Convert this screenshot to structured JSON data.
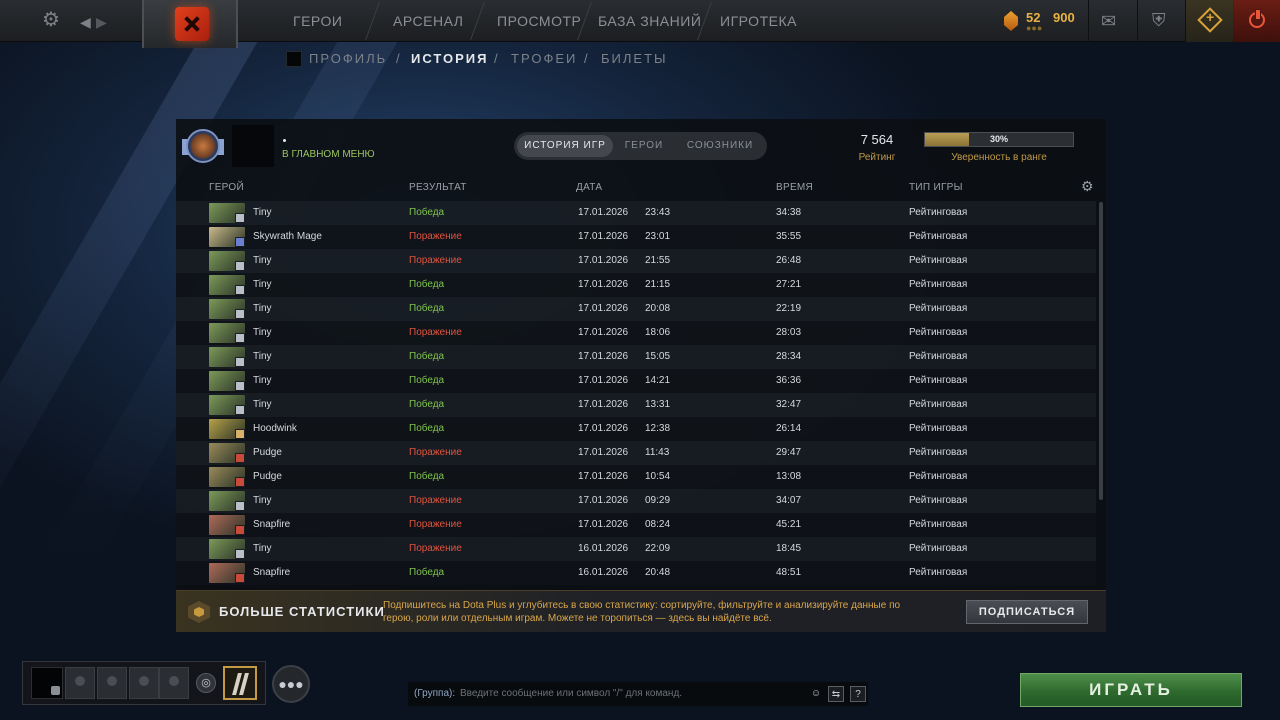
{
  "topbar": {
    "nav": [
      "ГЕРОИ",
      "АРСЕНАЛ",
      "ПРОСМОТР",
      "БАЗА ЗНАНИЙ",
      "ИГРОТЕКА"
    ],
    "currency_main": "52",
    "currency_secondary": "900"
  },
  "subnav": {
    "items": [
      "ПРОФИЛЬ",
      "ИСТОРИЯ",
      "ТРОФЕИ",
      "БИЛЕТЫ"
    ],
    "separator": "/",
    "active": "ИСТОРИЯ"
  },
  "profile": {
    "status": "В ГЛАВНОМ МЕНЮ"
  },
  "tabs": [
    "ИСТОРИЯ ИГР",
    "ГЕРОИ",
    "СОЮЗНИКИ"
  ],
  "rating": {
    "value": "7 564",
    "label": "Рейтинг"
  },
  "confidence": {
    "percent": 0.3,
    "text": "30%",
    "label": "Уверенность в ранге"
  },
  "columns": [
    "ГЕРОЙ",
    "РЕЗУЛЬТАТ",
    "ДАТА",
    "ВРЕМЯ",
    "ТИП ИГРЫ"
  ],
  "matches": [
    {
      "hero": "Tiny",
      "result": "Победа",
      "outcome": "win",
      "date": "17.01.2026",
      "time": "23:43",
      "duration": "34:38",
      "type": "Рейтинговая",
      "color": "#7d9a5a",
      "badge": "#b8bfc9"
    },
    {
      "hero": "Skywrath Mage",
      "result": "Поражение",
      "outcome": "loss",
      "date": "17.01.2026",
      "time": "23:01",
      "duration": "35:55",
      "type": "Рейтинговая",
      "color": "#c9b98a",
      "badge": "#6b7ed0"
    },
    {
      "hero": "Tiny",
      "result": "Поражение",
      "outcome": "loss",
      "date": "17.01.2026",
      "time": "21:55",
      "duration": "26:48",
      "type": "Рейтинговая",
      "color": "#7d9a5a",
      "badge": "#b8bfc9"
    },
    {
      "hero": "Tiny",
      "result": "Победа",
      "outcome": "win",
      "date": "17.01.2026",
      "time": "21:15",
      "duration": "27:21",
      "type": "Рейтинговая",
      "color": "#7d9a5a",
      "badge": "#b8bfc9"
    },
    {
      "hero": "Tiny",
      "result": "Победа",
      "outcome": "win",
      "date": "17.01.2026",
      "time": "20:08",
      "duration": "22:19",
      "type": "Рейтинговая",
      "color": "#7d9a5a",
      "badge": "#b8bfc9"
    },
    {
      "hero": "Tiny",
      "result": "Поражение",
      "outcome": "loss",
      "date": "17.01.2026",
      "time": "18:06",
      "duration": "28:03",
      "type": "Рейтинговая",
      "color": "#7d9a5a",
      "badge": "#b8bfc9"
    },
    {
      "hero": "Tiny",
      "result": "Победа",
      "outcome": "win",
      "date": "17.01.2026",
      "time": "15:05",
      "duration": "28:34",
      "type": "Рейтинговая",
      "color": "#7d9a5a",
      "badge": "#b8bfc9"
    },
    {
      "hero": "Tiny",
      "result": "Победа",
      "outcome": "win",
      "date": "17.01.2026",
      "time": "14:21",
      "duration": "36:36",
      "type": "Рейтинговая",
      "color": "#7d9a5a",
      "badge": "#b8bfc9"
    },
    {
      "hero": "Tiny",
      "result": "Победа",
      "outcome": "win",
      "date": "17.01.2026",
      "time": "13:31",
      "duration": "32:47",
      "type": "Рейтинговая",
      "color": "#7d9a5a",
      "badge": "#b8bfc9"
    },
    {
      "hero": "Hoodwink",
      "result": "Победа",
      "outcome": "win",
      "date": "17.01.2026",
      "time": "12:38",
      "duration": "26:14",
      "type": "Рейтинговая",
      "color": "#b7a24a",
      "badge": "#d9b06a"
    },
    {
      "hero": "Pudge",
      "result": "Поражение",
      "outcome": "loss",
      "date": "17.01.2026",
      "time": "11:43",
      "duration": "29:47",
      "type": "Рейтинговая",
      "color": "#9a8a5a",
      "badge": "#c94a3a"
    },
    {
      "hero": "Pudge",
      "result": "Победа",
      "outcome": "win",
      "date": "17.01.2026",
      "time": "10:54",
      "duration": "13:08",
      "type": "Рейтинговая",
      "color": "#9a8a5a",
      "badge": "#c94a3a"
    },
    {
      "hero": "Tiny",
      "result": "Поражение",
      "outcome": "loss",
      "date": "17.01.2026",
      "time": "09:29",
      "duration": "34:07",
      "type": "Рейтинговая",
      "color": "#7d9a5a",
      "badge": "#b8bfc9"
    },
    {
      "hero": "Snapfire",
      "result": "Поражение",
      "outcome": "loss",
      "date": "17.01.2026",
      "time": "08:24",
      "duration": "45:21",
      "type": "Рейтинговая",
      "color": "#b06a5a",
      "badge": "#c94a3a"
    },
    {
      "hero": "Tiny",
      "result": "Поражение",
      "outcome": "loss",
      "date": "16.01.2026",
      "time": "22:09",
      "duration": "18:45",
      "type": "Рейтинговая",
      "color": "#7d9a5a",
      "badge": "#b8bfc9"
    },
    {
      "hero": "Snapfire",
      "result": "Победа",
      "outcome": "win",
      "date": "16.01.2026",
      "time": "20:48",
      "duration": "48:51",
      "type": "Рейтинговая",
      "color": "#b06a5a",
      "badge": "#c94a3a"
    }
  ],
  "promo": {
    "title": "БОЛЬШЕ СТАТИСТИКИ",
    "description": "Подпишитесь на Dota Plus и углубитесь в свою статистику: сортируйте, фильтруйте и анализируйте данные по герою, роли или отдельным играм. Можете не торопиться — здесь вы найдёте всё.",
    "button": "ПОДПИСАТЬСЯ"
  },
  "chat": {
    "group_label": "(Группа):",
    "placeholder": "Введите сообщение или символ \"/\" для команд.",
    "help": "?"
  },
  "play_button": "ИГРАТЬ",
  "colors": {
    "win": "#7fc44b",
    "loss": "#e0533f",
    "gold": "#c09a46",
    "play": "#2e6a2e"
  }
}
